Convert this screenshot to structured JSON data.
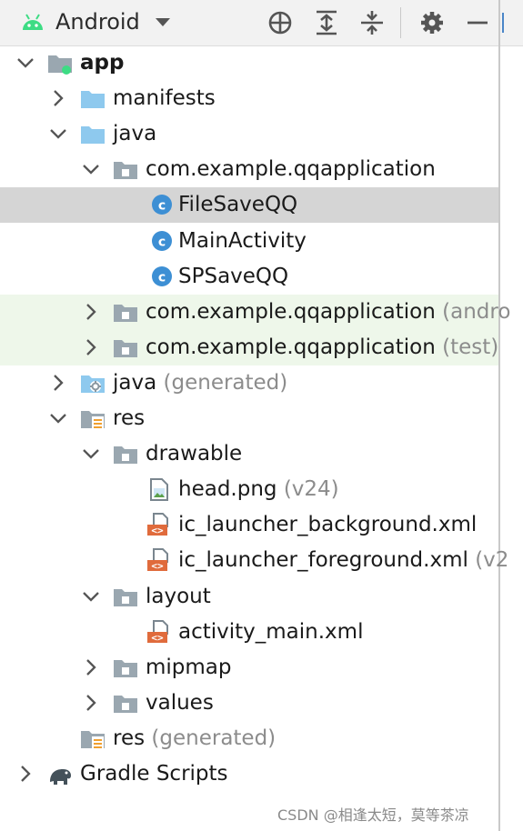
{
  "toolbar": {
    "view_name": "Android",
    "icons": [
      "android-icon",
      "dropdown-caret-icon",
      "locate-target-icon",
      "expand-all-icon",
      "collapse-all-icon",
      "gear-icon",
      "minimize-icon"
    ]
  },
  "tree": [
    {
      "id": "app",
      "label": "app",
      "hint": "",
      "bold": true,
      "icon": "module-icon",
      "expanded": true
    },
    {
      "id": "manifests",
      "label": "manifests",
      "hint": "",
      "icon": "folder-icon",
      "expanded": false
    },
    {
      "id": "java",
      "label": "java",
      "hint": "",
      "icon": "folder-icon",
      "expanded": true
    },
    {
      "id": "pkg-main",
      "label": "com.example.qqapplication",
      "hint": "",
      "icon": "package-icon",
      "expanded": true
    },
    {
      "id": "filesaveqq",
      "label": "FileSaveQQ",
      "hint": "",
      "icon": "class-icon",
      "selected": true
    },
    {
      "id": "mainactivity",
      "label": "MainActivity",
      "hint": "",
      "icon": "class-icon"
    },
    {
      "id": "spsaveqq",
      "label": "SPSaveQQ",
      "hint": "",
      "icon": "class-icon"
    },
    {
      "id": "pkg-android",
      "label": "com.example.qqapplication",
      "hint": "(andro",
      "icon": "package-icon",
      "expanded": false
    },
    {
      "id": "pkg-test",
      "label": "com.example.qqapplication",
      "hint": "(test)",
      "icon": "package-icon",
      "expanded": false
    },
    {
      "id": "java-gen",
      "label": "java",
      "hint": "(generated)",
      "icon": "generated-folder-icon",
      "expanded": false
    },
    {
      "id": "res",
      "label": "res",
      "hint": "",
      "icon": "resource-folder-icon",
      "expanded": true
    },
    {
      "id": "drawable",
      "label": "drawable",
      "hint": "",
      "icon": "package-icon",
      "expanded": true
    },
    {
      "id": "head",
      "label": "head.png",
      "hint": "(v24)",
      "icon": "image-file-icon"
    },
    {
      "id": "ic-bg",
      "label": "ic_launcher_background.xml",
      "hint": "",
      "icon": "xml-file-icon"
    },
    {
      "id": "ic-fg",
      "label": "ic_launcher_foreground.xml",
      "hint": "(v2",
      "icon": "xml-file-icon"
    },
    {
      "id": "layout",
      "label": "layout",
      "hint": "",
      "icon": "package-icon",
      "expanded": true
    },
    {
      "id": "activity-main",
      "label": "activity_main.xml",
      "hint": "",
      "icon": "xml-file-icon"
    },
    {
      "id": "mipmap",
      "label": "mipmap",
      "hint": "",
      "icon": "package-icon",
      "expanded": false
    },
    {
      "id": "values",
      "label": "values",
      "hint": "",
      "icon": "package-icon",
      "expanded": false
    },
    {
      "id": "res-gen",
      "label": "res",
      "hint": "(generated)",
      "icon": "resource-folder-icon"
    },
    {
      "id": "gradle",
      "label": "Gradle Scripts",
      "hint": "",
      "icon": "gradle-elephant-icon",
      "expanded": false
    }
  ],
  "watermark": "CSDN @相逢太短，莫等茶凉",
  "colors": {
    "toolbar_bg": "#f2f2f2",
    "selected_row": "#d5d5d5",
    "test_source_row": "#eef7ea",
    "folder_blue": "#8ec9ee",
    "package_grey": "#9aa7b0",
    "class_icon": "#3d8fd4",
    "xml_icon": "#e06b3c",
    "android_green": "#3ddc84",
    "hint_grey": "#8c8c8c"
  }
}
